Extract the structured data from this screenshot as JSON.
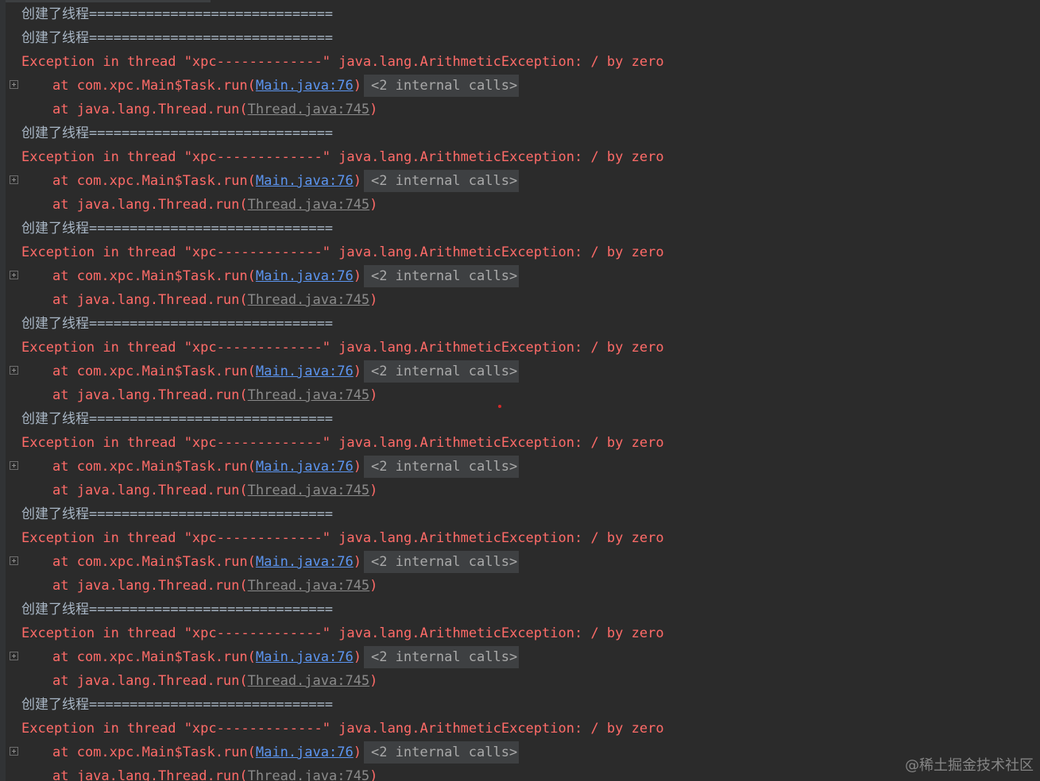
{
  "console": {
    "thread_created": "创建了线程==============================",
    "exception_text": "Exception in thread \"xpc-------------\" java.lang.ArithmeticException: / by zero",
    "frame1_prefix": "at com.xpc.Main$Task.run(",
    "frame1_link": "Main.java:76",
    "frame1_suffix": ")",
    "internal_calls": "<2 internal calls>",
    "frame2_prefix": "at java.lang.Thread.run(",
    "frame2_link": "Thread.java:745",
    "frame2_suffix": ")",
    "blocks": [
      {
        "id": 1
      },
      {
        "id": 2
      },
      {
        "id": 3
      },
      {
        "id": 4
      },
      {
        "id": 5
      },
      {
        "id": 6
      },
      {
        "id": 7
      },
      {
        "id": 8
      }
    ]
  },
  "watermark": "@稀土掘金技术社区",
  "colors": {
    "background": "#2b2b2b",
    "error_red": "#ff6b68",
    "link_blue": "#5c95f0",
    "normal_text": "#a9b7c6",
    "muted_link": "#8a8a8a"
  },
  "icons": {
    "fold": "fold-expand-icon"
  }
}
